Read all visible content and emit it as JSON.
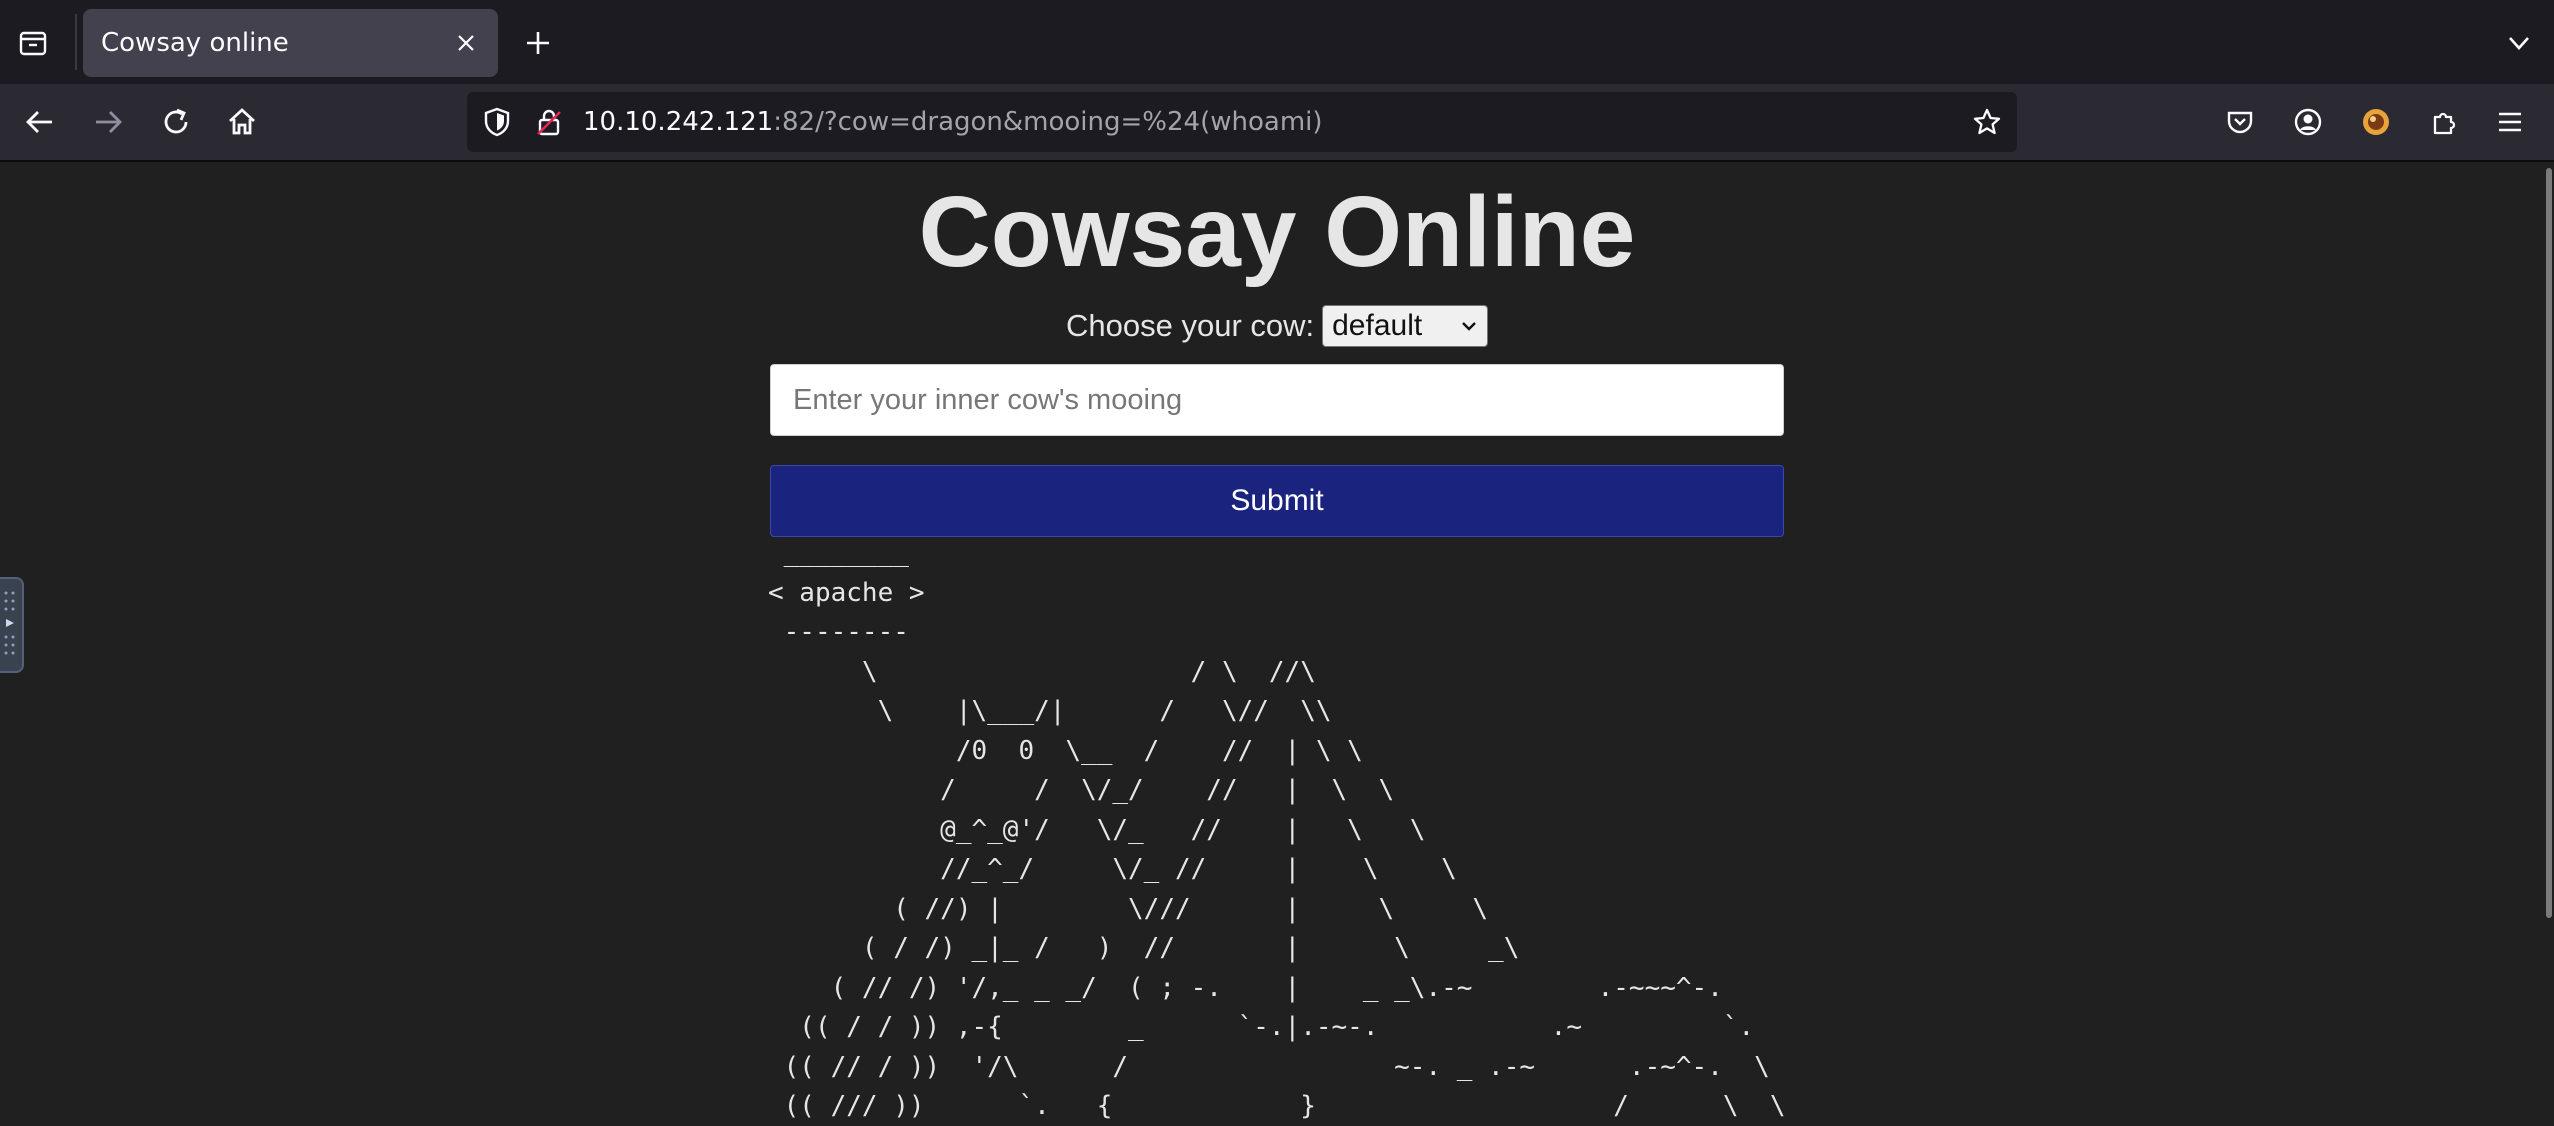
{
  "browser": {
    "tab": {
      "title": "Cowsay online"
    },
    "urlbar": {
      "host": "10.10.242.121",
      "rest": ":82/?cow=dragon&mooing=%24(whoami)"
    },
    "icons": {
      "firefox_view": "firefox-view-icon",
      "tab_close": "close-icon",
      "new_tab": "plus-icon",
      "tab_list": "chevron-down-icon",
      "back": "arrow-left-icon",
      "forward": "arrow-right-icon",
      "reload": "reload-icon",
      "home": "home-icon",
      "shield": "shield-icon",
      "lock": "lock-insecure-icon",
      "bookmark": "star-icon",
      "pocket": "pocket-icon",
      "account": "account-icon",
      "extension": "extension-icon",
      "extensions": "puzzle-icon",
      "menu": "hamburger-menu-icon"
    }
  },
  "page": {
    "title": "Cowsay Online",
    "cow_label": "Choose your cow:",
    "cow_selected": "default",
    "input_placeholder": "Enter your inner cow's mooing",
    "input_value": "",
    "submit_label": "Submit",
    "output": " ________\n< apache >\n --------\n      \\                    / \\  //\\\n       \\    |\\___/|      /   \\//  \\\\\n            /0  0  \\__  /    //  | \\ \\\n           /     /  \\/_/    //   |  \\  \\\n           @_^_@'/   \\/_   //    |   \\   \\\n           //_^_/     \\/_ //     |    \\    \\\n        ( //) |        \\///      |     \\     \\\n      ( / /) _|_ /   )  //       |      \\     _\\\n    ( // /) '/,_ _ _/  ( ; -.    |    _ _\\.-~        .-~~~^-.\n  (( / / )) ,-{        _      `-.|.-~-.           .~         `.\n (( // / ))  '/\\      /                 ~-. _ .-~      .-~^-.  \\\n (( /// ))      `.   {            }                   /      \\  \\"
  },
  "colors": {
    "chrome_bg": "#1c1b22",
    "navbar_bg": "#2b2a33",
    "tab_bg": "#42414d",
    "page_bg": "#202020",
    "submit_bg": "#1a237e",
    "text": "#e6e6e6"
  }
}
